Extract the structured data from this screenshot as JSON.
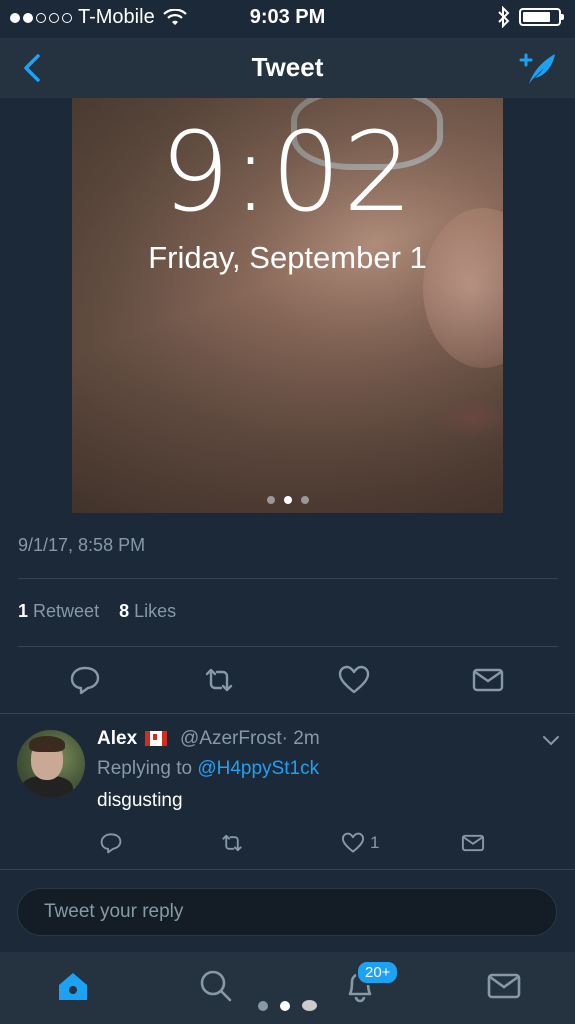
{
  "status": {
    "carrier": "T-Mobile",
    "time": "9:03 PM"
  },
  "nav": {
    "title": "Tweet"
  },
  "media": {
    "lock_time": "9:02",
    "lock_date": "Friday, September 1"
  },
  "tweet": {
    "timestamp": "9/1/17, 8:58 PM",
    "retweet_count": "1",
    "retweet_label": "Retweet",
    "likes_count": "8",
    "likes_label": "Likes"
  },
  "reply": {
    "name": "Alex",
    "handle": "@AzerFrost",
    "time": "· 2m",
    "replying_prefix": "Replying to",
    "replying_to": "@H4ppySt1ck",
    "text": "disgusting",
    "like_count": "1"
  },
  "composer": {
    "placeholder": "Tweet your reply"
  },
  "tabs": {
    "notifications_badge": "20+"
  },
  "colors": {
    "background": "#1c2938",
    "bar": "#253341",
    "accent": "#1da1f2",
    "muted": "#8899a6"
  }
}
